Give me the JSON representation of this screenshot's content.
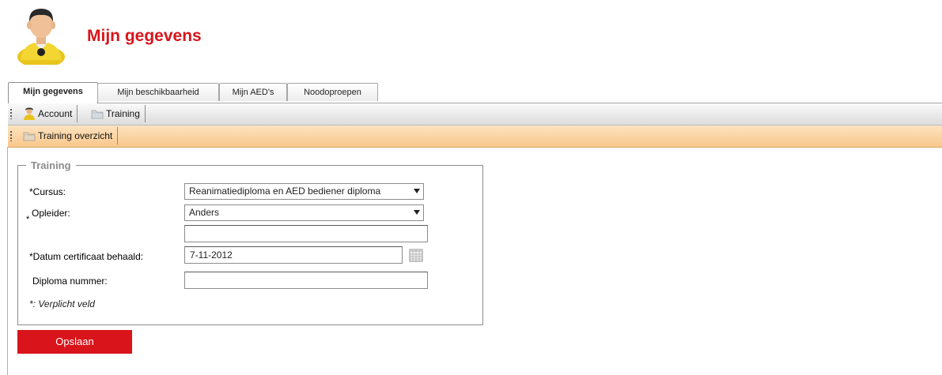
{
  "header": {
    "title": "Mijn gegevens",
    "avatar_icon": "user-avatar-icon"
  },
  "tabs": [
    {
      "label": "Mijn gegevens",
      "active": true
    },
    {
      "label": "Mijn beschikbaarheid",
      "active": false
    },
    {
      "label": "Mijn AED's",
      "active": false
    },
    {
      "label": "Noodoproepen",
      "active": false
    }
  ],
  "toolbar": {
    "account_label": "Account",
    "account_icon": "user-icon",
    "training_label": "Training",
    "training_icon": "folder-icon"
  },
  "subtoolbar": {
    "overview_label": "Training overzicht",
    "overview_icon": "folder-icon",
    "color": "#f8c78a"
  },
  "form": {
    "legend": "Training",
    "cursus_label": "*Cursus:",
    "cursus_value": "Reanimatiediploma en AED bediener diploma",
    "opleider_label": "Opleider:",
    "opleider_star": "*",
    "opleider_value": "Anders",
    "opleider_other_value": "",
    "datum_label": "*Datum certificaat behaald:",
    "datum_value": "7-11-2012",
    "calendar_icon": "calendar-icon",
    "diploma_label": "Diploma nummer:",
    "diploma_value": "",
    "required_note": "*: Verplicht veld"
  },
  "save_button": {
    "label": "Opslaan",
    "color": "#d9141b"
  },
  "colors": {
    "title": "#d9141b",
    "accent": "#d9141b"
  }
}
